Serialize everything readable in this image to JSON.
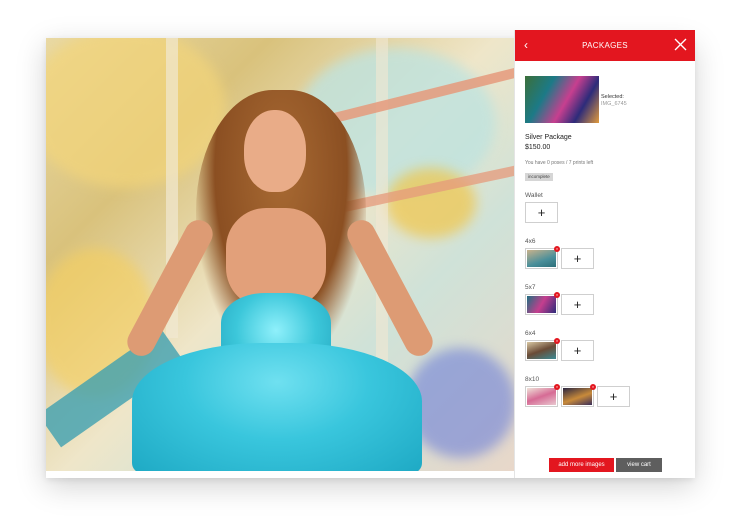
{
  "panel": {
    "title": "PACKAGES",
    "back_icon": "chevron-left-icon",
    "close_icon": "close-icon",
    "accent_color": "#e3161f"
  },
  "selected": {
    "label": "Selected:",
    "name": "IMG_6745"
  },
  "package": {
    "name": "Silver Package",
    "price": "$150.00",
    "remaining": "You have 0 poses / 7 prints left",
    "status": "incomplete"
  },
  "sections": [
    {
      "label": "Wallet",
      "slots": 0
    },
    {
      "label": "4x6",
      "slots": 1
    },
    {
      "label": "5x7",
      "slots": 1
    },
    {
      "label": "6x4",
      "slots": 1
    },
    {
      "label": "8x10",
      "slots": 2
    }
  ],
  "add_symbol": "+",
  "remove_symbol": "×",
  "buttons": {
    "add_more": "add more images",
    "view_cart": "view cart"
  }
}
